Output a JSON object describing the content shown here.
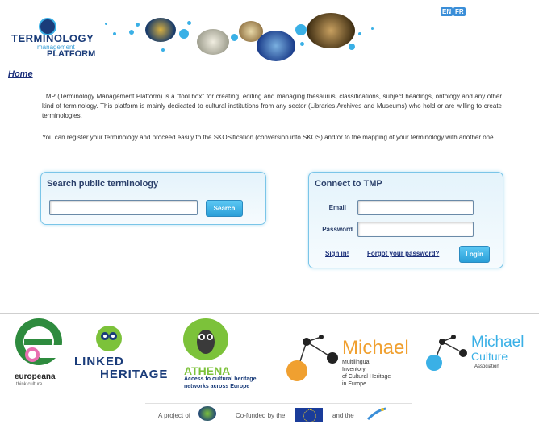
{
  "header": {
    "logo_line1": "TERMINOLOGY",
    "logo_line2": "management",
    "logo_line3": "PLATFORM",
    "lang_en": "EN",
    "lang_fr": "FR"
  },
  "nav": {
    "home": "Home"
  },
  "intro": {
    "p1": "TMP (Terminology Management Platform) is a \"tool box\" for creating, editing and managing thesaurus, classifications, subject headings, ontology and any other kind of terminology. This platform is mainly dedicated to cultural institutions from any sector (Libraries Archives and Museums) who hold or are willing to create terminologies.",
    "p2": "You can register your terminology and proceed easily to the SKOSification (conversion into SKOS) and/or to the mapping of your terminology with another one."
  },
  "search": {
    "title": "Search public terminology",
    "value": "",
    "button": "Search"
  },
  "login": {
    "title": "Connect to TMP",
    "email_label": "Email",
    "password_label": "Password",
    "email_value": "",
    "password_value": "",
    "signin": "Sign in!",
    "forgot": "Forgot your password?",
    "button": "Login"
  },
  "partners": {
    "europeana_name": "europeana",
    "europeana_tag": "think culture",
    "linked_line1": "LINKED",
    "linked_line2": "HERITAGE",
    "athena_name": "ATHENA",
    "athena_tag1": "Access to cultural heritage",
    "athena_tag2": "networks across Europe",
    "michael1_name": "Michael",
    "michael1_tag1": "Multilingual",
    "michael1_tag2": "Inventory",
    "michael1_tag3": "of Cultural Heritage",
    "michael1_tag4": "in Europe",
    "michael2_name1": "Michael",
    "michael2_name2": "Culture",
    "michael2_tag": "Association"
  },
  "footer": {
    "project_of": "A project of",
    "cofunded": "Co-funded by the",
    "and_the": "and the"
  },
  "colors": {
    "accent": "#3ab0e6",
    "navy": "#1a2e7a",
    "athena_green": "#7cc23a",
    "michael_orange": "#f0a030"
  }
}
